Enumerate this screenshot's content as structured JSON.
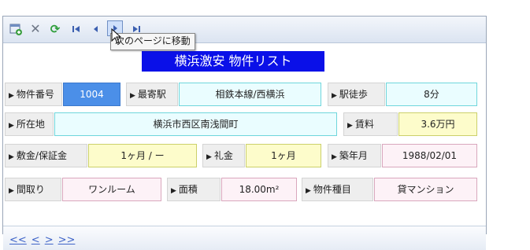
{
  "toolbar": {
    "icons": [
      "new-record-icon",
      "delete-icon",
      "refresh-icon",
      "first-page-icon",
      "prev-page-icon",
      "next-page-icon",
      "last-page-icon"
    ]
  },
  "tooltip": {
    "text": "次のページに移動"
  },
  "title": {
    "text": "激安 物件リスト",
    "hidden_prefix": "横浜"
  },
  "fields": {
    "bukken_bango": {
      "label": "物件番号",
      "value": "1004"
    },
    "mogori_eki": {
      "label": "最寄駅",
      "value": "相鉄本線/西横浜"
    },
    "eki_toho": {
      "label": "駅徒歩",
      "value": "8分"
    },
    "shozaichi": {
      "label": "所在地",
      "value": "横浜市西区南浅間町"
    },
    "chinryo": {
      "label": "賃料",
      "value": "3.6万円"
    },
    "shikikin": {
      "label": "敷金/保証金",
      "value": "1ヶ月 / ー"
    },
    "reikin": {
      "label": "礼金",
      "value": "1ヶ月"
    },
    "chikunengetsu": {
      "label": "築年月",
      "value": "1988/02/01"
    },
    "madori": {
      "label": "間取り",
      "value": "ワンルーム"
    },
    "menseki": {
      "label": "面積",
      "value": "18.00m²"
    },
    "shubetsu": {
      "label": "物件種目",
      "value": "貸マンション"
    }
  },
  "pager": {
    "first": "<<",
    "prev": "<",
    "next": ">",
    "last": ">>"
  },
  "colors": {
    "toolbar_bg": "#dbe4f1",
    "title_bg": "#0a10e8",
    "selected_value": "#4b8fe8"
  }
}
